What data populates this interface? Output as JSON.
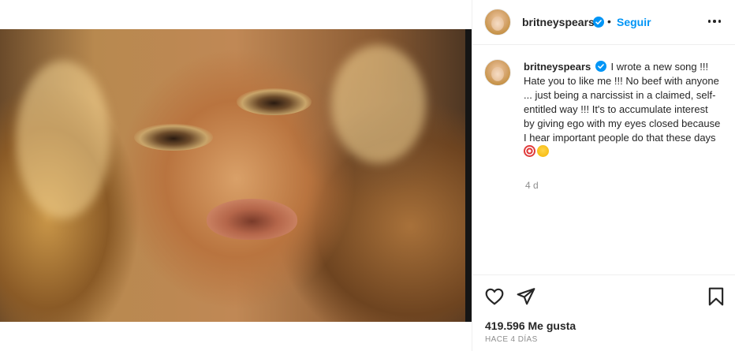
{
  "post": {
    "author": "britneyspears",
    "follow_label": "Seguir",
    "separator": "•",
    "caption_text": "I wrote a new song !!! Hate you to like me !!! No beef with anyone ... just being a narcissist in a claimed, self-entitled way !!! It's to accumulate interest by giving ego with my eyes closed because I hear important people do that these days",
    "caption_emojis": [
      "direct-hit-emoji",
      "winking-face-emoji"
    ],
    "caption_time": "4 d",
    "likes": "419.596 Me gusta",
    "timestamp": "HACE 4 DÍAS"
  },
  "icons": {
    "verified": "verified-badge-icon",
    "more": "more-options-icon",
    "like": "heart-icon",
    "share": "paper-plane-icon",
    "save": "bookmark-icon"
  },
  "colors": {
    "accent": "#0095f6",
    "text": "#262626",
    "muted": "#8e8e8e",
    "border": "#efefef"
  }
}
